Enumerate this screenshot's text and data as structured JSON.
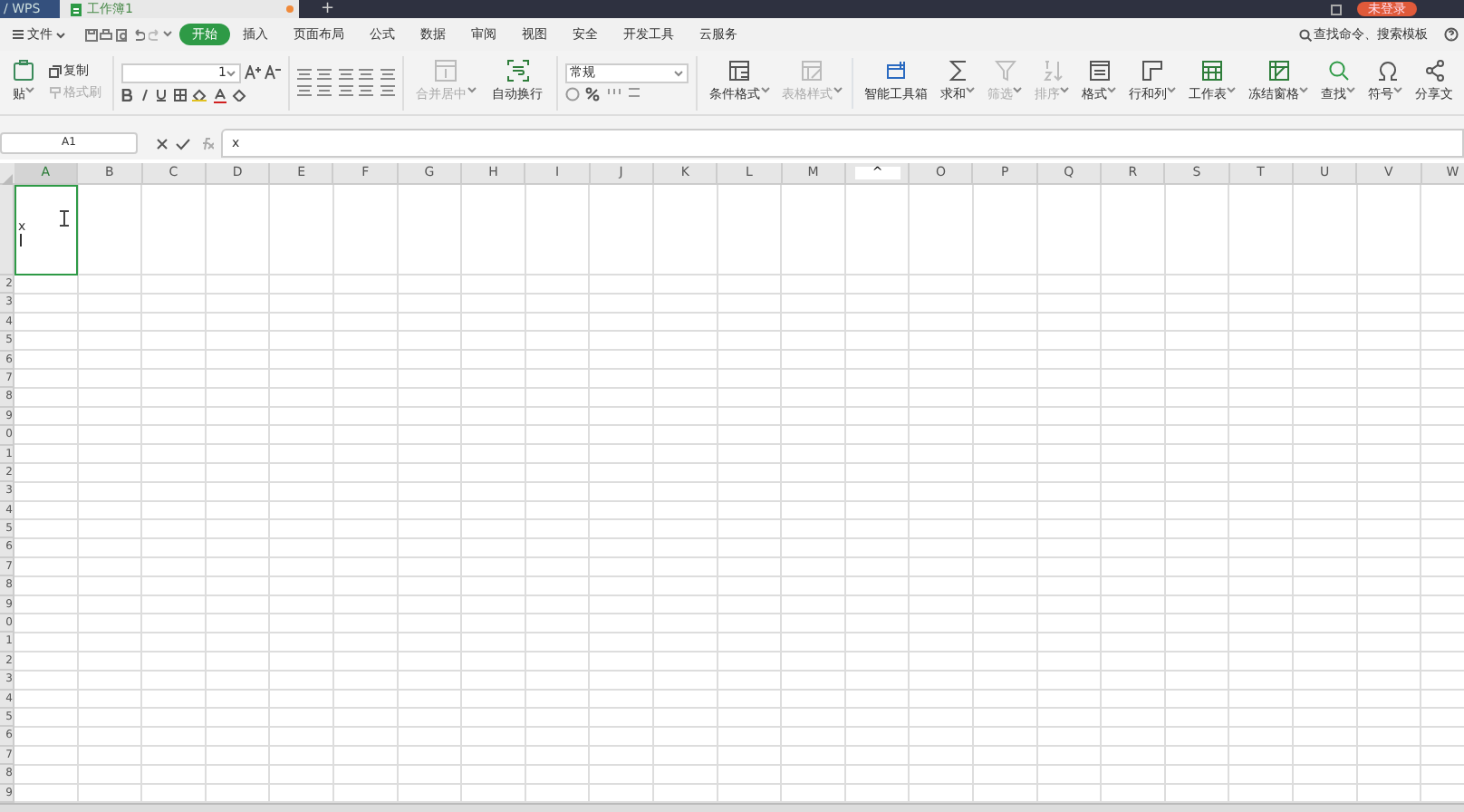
{
  "title_bar": {
    "app_tab": "/ WPS",
    "doc_tab": {
      "label": "工作簿1",
      "selected": true,
      "unsaved": true
    },
    "new_tab": "+",
    "login_button": "未登录"
  },
  "menu": {
    "file": "文件",
    "tabs": [
      {
        "label": "开始",
        "selected": true
      },
      {
        "label": "插入",
        "selected": false
      },
      {
        "label": "页面布局",
        "selected": false
      },
      {
        "label": "公式",
        "selected": false
      },
      {
        "label": "数据",
        "selected": false
      },
      {
        "label": "审阅",
        "selected": false
      },
      {
        "label": "视图",
        "selected": false
      },
      {
        "label": "安全",
        "selected": false
      },
      {
        "label": "开发工具",
        "selected": false
      },
      {
        "label": "云服务",
        "selected": false
      }
    ],
    "search": "查找命令、搜索模板"
  },
  "ribbon": {
    "clipboard": [
      {
        "label": "贴",
        "disabled": false,
        "dropdown": true
      },
      {
        "label": "复制",
        "disabled": false,
        "dropdown": false
      },
      {
        "label": "格式刷",
        "disabled": true,
        "dropdown": false
      }
    ],
    "font_size": "1",
    "merge": {
      "label": "合并居中",
      "disabled": true
    },
    "wrap": {
      "label": "自动换行",
      "disabled": false
    },
    "number_format": "常规",
    "tools": [
      {
        "label": "条件格式",
        "disabled": false,
        "dropdown": true
      },
      {
        "label": "表格样式",
        "disabled": true,
        "dropdown": true
      },
      {
        "label": "智能工具箱",
        "disabled": false,
        "dropdown": false
      },
      {
        "label": "求和",
        "disabled": false,
        "dropdown": true
      },
      {
        "label": "筛选",
        "disabled": true,
        "dropdown": true
      },
      {
        "label": "排序",
        "disabled": true,
        "dropdown": true
      },
      {
        "label": "格式",
        "disabled": false,
        "dropdown": true
      },
      {
        "label": "行和列",
        "disabled": false,
        "dropdown": true
      },
      {
        "label": "工作表",
        "disabled": false,
        "dropdown": true
      },
      {
        "label": "冻结窗格",
        "disabled": false,
        "dropdown": true
      },
      {
        "label": "查找",
        "disabled": false,
        "dropdown": true
      },
      {
        "label": "符号",
        "disabled": false,
        "dropdown": true
      },
      {
        "label": "分享文",
        "disabled": false,
        "dropdown": false
      }
    ]
  },
  "formula_bar": {
    "name_box": "A1",
    "formula": "x"
  },
  "sheet": {
    "columns": [
      {
        "label": "A",
        "kind": "letter"
      },
      {
        "label": "B",
        "kind": "letter"
      },
      {
        "label": "C",
        "kind": "letter"
      },
      {
        "label": "D",
        "kind": "letter"
      },
      {
        "label": "E",
        "kind": "letter"
      },
      {
        "label": "F",
        "kind": "letter"
      },
      {
        "label": "G",
        "kind": "letter"
      },
      {
        "label": "H",
        "kind": "letter"
      },
      {
        "label": "I",
        "kind": "letter"
      },
      {
        "label": "J",
        "kind": "letter"
      },
      {
        "label": "K",
        "kind": "letter"
      },
      {
        "label": "L",
        "kind": "letter"
      },
      {
        "label": "M",
        "kind": "letter"
      },
      {
        "label": "^",
        "kind": "toggle"
      },
      {
        "label": "O",
        "kind": "letter"
      },
      {
        "label": "P",
        "kind": "letter"
      },
      {
        "label": "Q",
        "kind": "letter"
      },
      {
        "label": "R",
        "kind": "letter"
      },
      {
        "label": "S",
        "kind": "letter"
      },
      {
        "label": "T",
        "kind": "letter"
      },
      {
        "label": "U",
        "kind": "letter"
      },
      {
        "label": "V",
        "kind": "letter"
      },
      {
        "label": "W",
        "kind": "letter"
      }
    ],
    "rows": [
      "2",
      "3",
      "4",
      "5",
      "6",
      "7",
      "8",
      "9",
      "0",
      "1",
      "2",
      "3",
      "4",
      "5",
      "6",
      "7",
      "8",
      "9",
      "0",
      "1",
      "2",
      "3",
      "4",
      "5",
      "6",
      "7",
      "8",
      "9"
    ],
    "a1": {
      "value": "x",
      "selected": true
    }
  }
}
